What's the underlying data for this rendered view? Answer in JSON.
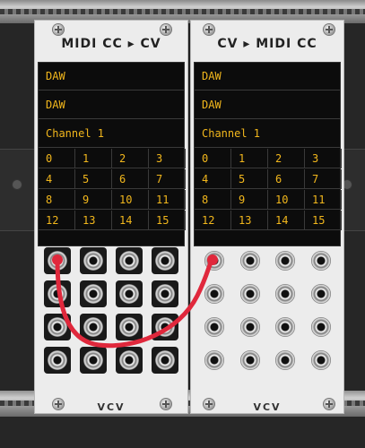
{
  "modules": [
    {
      "title": "MIDI CC ▸ CV",
      "display": {
        "row1": "DAW",
        "row2": "DAW",
        "row3": "Channel 1"
      },
      "cc_grid": [
        "0",
        "1",
        "2",
        "3",
        "4",
        "5",
        "6",
        "7",
        "8",
        "9",
        "10",
        "11",
        "12",
        "13",
        "14",
        "15"
      ],
      "logo": "VCV"
    },
    {
      "title": "CV ▸ MIDI CC",
      "display": {
        "row1": "DAW",
        "row2": "DAW",
        "row3": "Channel 1"
      },
      "cc_grid": [
        "0",
        "1",
        "2",
        "3",
        "4",
        "5",
        "6",
        "7",
        "8",
        "9",
        "10",
        "11",
        "12",
        "13",
        "14",
        "15"
      ],
      "logo": "VCV"
    }
  ],
  "colors": {
    "display_text": "#f2b71c",
    "cable": "#e0283c",
    "panel": "#ececec"
  },
  "cable": {
    "from": "midi-cc-cv output jack 1",
    "to": "cv-midi-cc input jack 1"
  }
}
